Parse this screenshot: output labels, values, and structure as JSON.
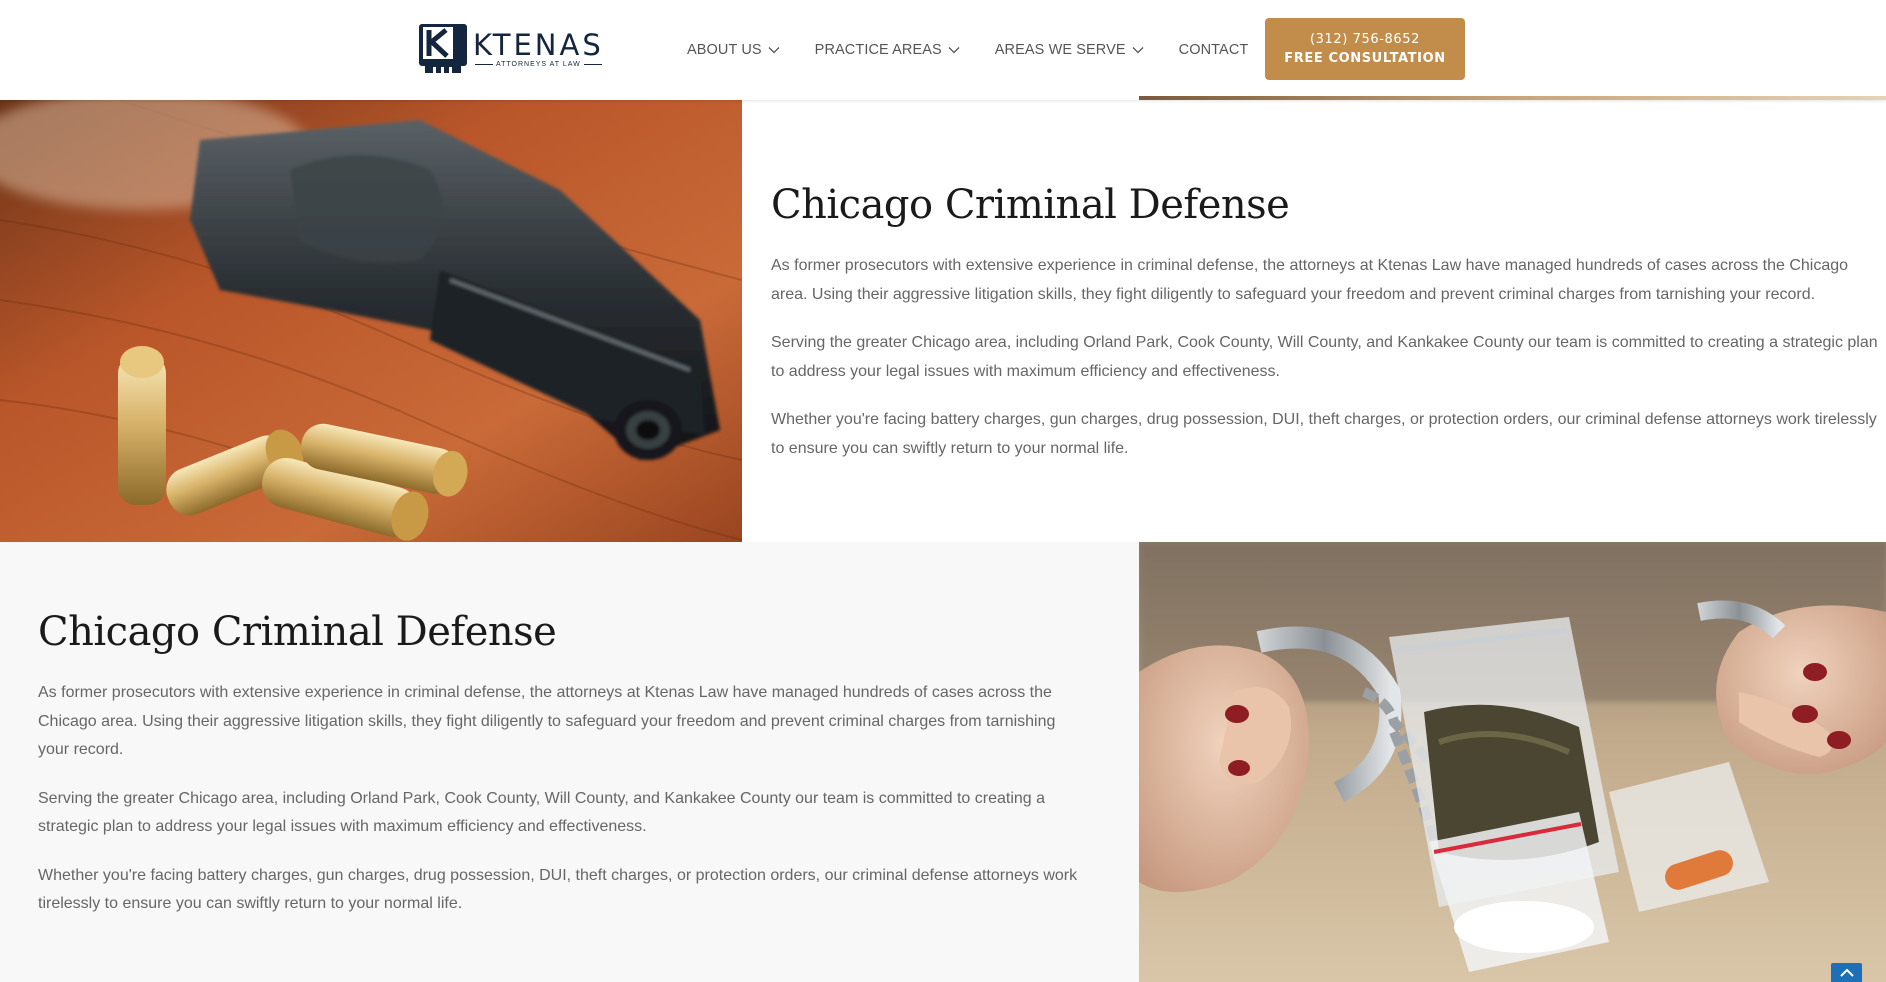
{
  "header": {
    "logo": {
      "name": "KTENAS",
      "tagline": "ATTORNEYS AT LAW",
      "mark_letter": "K"
    },
    "nav": [
      {
        "label": "ABOUT US",
        "has_dropdown": true
      },
      {
        "label": "PRACTICE AREAS",
        "has_dropdown": true
      },
      {
        "label": "AREAS WE SERVE",
        "has_dropdown": true
      },
      {
        "label": "CONTACT",
        "has_dropdown": false
      }
    ],
    "cta": {
      "phone": "(312) 756-8652",
      "label": "FREE CONSULTATION"
    }
  },
  "section1": {
    "image": "revolver-and-bullets-photo",
    "title": "Chicago Criminal Defense",
    "paragraphs": [
      "As former prosecutors with extensive experience in criminal defense, the attorneys at Ktenas Law have managed hundreds of cases across the Chicago area. Using their aggressive litigation skills, they fight diligently to safeguard your freedom and prevent criminal charges from tarnishing your record.",
      "Serving the greater Chicago area, including Orland Park, Cook County, Will County, and Kankakee County our team is committed to creating a strategic plan to address your legal issues with maximum efficiency and effectiveness.",
      "Whether you're facing battery charges, gun charges, drug possession, DUI, theft charges, or protection orders, our criminal defense attorneys work tirelessly to ensure you can swiftly return to your normal life."
    ]
  },
  "section2": {
    "image": "handcuffed-hands-with-drug-bags-photo",
    "title": "Chicago Criminal Defense",
    "paragraphs": [
      "As former prosecutors with extensive experience in criminal defense, the attorneys at Ktenas Law have managed hundreds of cases across the Chicago area. Using their aggressive litigation skills, they fight diligently to safeguard your freedom and prevent criminal charges from tarnishing your record.",
      "Serving the greater Chicago area, including Orland Park, Cook County, Will County, and Kankakee County our team is committed to creating a strategic plan to address your legal issues with maximum efficiency and effectiveness.",
      "Whether you're facing battery charges, gun charges, drug possession, DUI, theft charges, or protection orders, our criminal defense attorneys work tirelessly to ensure you can swiftly return to your normal life."
    ]
  },
  "scroll_top": {
    "icon": "chevron-up-icon"
  },
  "colors": {
    "accent": "#c28c4a",
    "navy": "#14253f",
    "text": "#666666",
    "heading": "#1a1a1a",
    "scroll_button": "#1d6fb8"
  }
}
